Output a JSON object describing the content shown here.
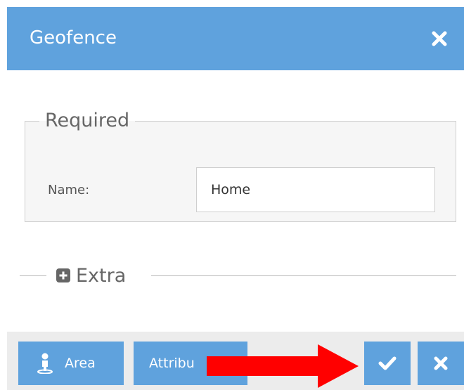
{
  "dialog": {
    "title": "Geofence",
    "accent_color": "#5fa2dd"
  },
  "required_section": {
    "legend": "Required",
    "name_label": "Name:",
    "name_value": "Home"
  },
  "extra_section": {
    "label": "Extra",
    "icon": "plus-square-icon"
  },
  "toolbar": {
    "area_label": "Area",
    "area_icon": "person-pin-icon",
    "attributes_label": "Attribu",
    "ok_icon": "check-icon",
    "cancel_icon": "close-icon"
  },
  "annotation": {
    "arrow_color": "#ff0000"
  }
}
